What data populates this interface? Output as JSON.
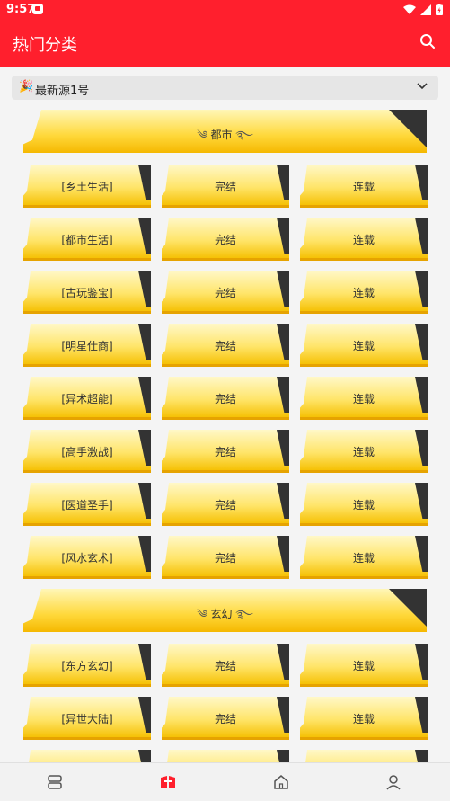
{
  "status_bar": {
    "time": "9:57"
  },
  "app_bar": {
    "title": "热门分类"
  },
  "source": {
    "emoji": "🎉",
    "label": "最新源1号"
  },
  "sections": [
    {
      "title": "都市",
      "rows": [
        [
          "[乡土生活]",
          "完结",
          "连载"
        ],
        [
          "[都市生活]",
          "完结",
          "连载"
        ],
        [
          "[古玩鉴宝]",
          "完结",
          "连载"
        ],
        [
          "[明星仕商]",
          "完结",
          "连载"
        ],
        [
          "[异术超能]",
          "完结",
          "连载"
        ],
        [
          "[高手激战]",
          "完结",
          "连载"
        ],
        [
          "[医道圣手]",
          "完结",
          "连载"
        ],
        [
          "[风水玄术]",
          "完结",
          "连载"
        ]
      ]
    },
    {
      "title": "玄幻",
      "rows": [
        [
          "[东方玄幻]",
          "完结",
          "连载"
        ],
        [
          "[异世大陆]",
          "完结",
          "连载"
        ],
        [
          "",
          "",
          ""
        ]
      ]
    }
  ],
  "colors": {
    "brand": "#ff1f2d",
    "tile_yellow": "#ffe56a",
    "corner_dark": "#333333"
  }
}
